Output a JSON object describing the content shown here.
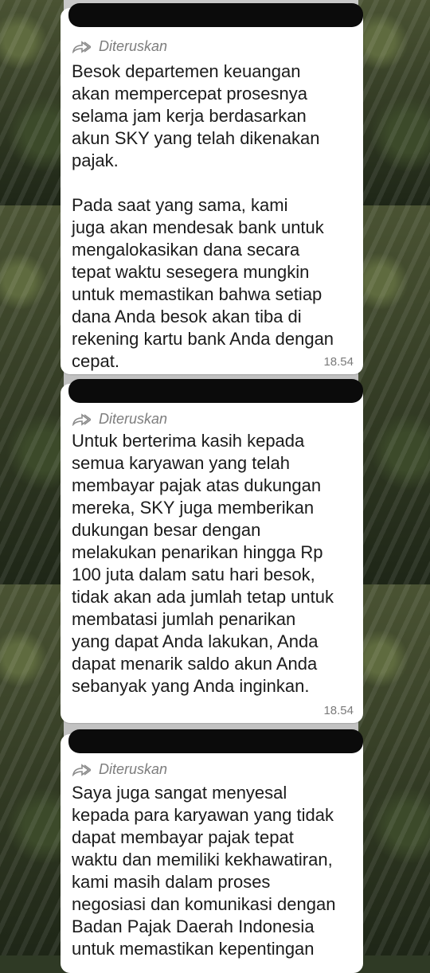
{
  "messages": [
    {
      "forwarded_label": "Diteruskan",
      "text": "Besok departemen keuangan\nakan mempercepat prosesnya\nselama jam kerja berdasarkan\nakun SKY yang telah dikenakan\npajak.\n\nPada saat yang sama, kami\njuga akan mendesak bank untuk\nmengalokasikan dana secara\ntepat waktu sesegera mungkin\nuntuk memastikan bahwa setiap\ndana Anda besok akan tiba di\nrekening kartu bank Anda dengan\ncepat.",
      "time": "18.54"
    },
    {
      "forwarded_label": "Diteruskan",
      "text": "Untuk berterima kasih kepada\nsemua karyawan yang telah\nmembayar pajak atas dukungan\nmereka, SKY juga memberikan\ndukungan besar dengan\nmelakukan penarikan hingga Rp\n100 juta dalam satu hari besok,\ntidak akan ada jumlah tetap untuk\nmembatasi jumlah penarikan\nyang dapat Anda lakukan, Anda\ndapat menarik saldo akun Anda\nsebanyak yang Anda inginkan.",
      "time": "18.54"
    },
    {
      "forwarded_label": "Diteruskan",
      "text": "Saya juga sangat menyesal\nkepada para karyawan yang tidak\ndapat membayar pajak tepat\nwaktu dan memiliki kekhawatiran,\nkami masih dalam proses\nnegosiasi dan komunikasi dengan\nBadan Pajak Daerah Indonesia\nuntuk memastikan kepentingan"
    }
  ],
  "icons": {
    "forward": "forward-icon"
  }
}
